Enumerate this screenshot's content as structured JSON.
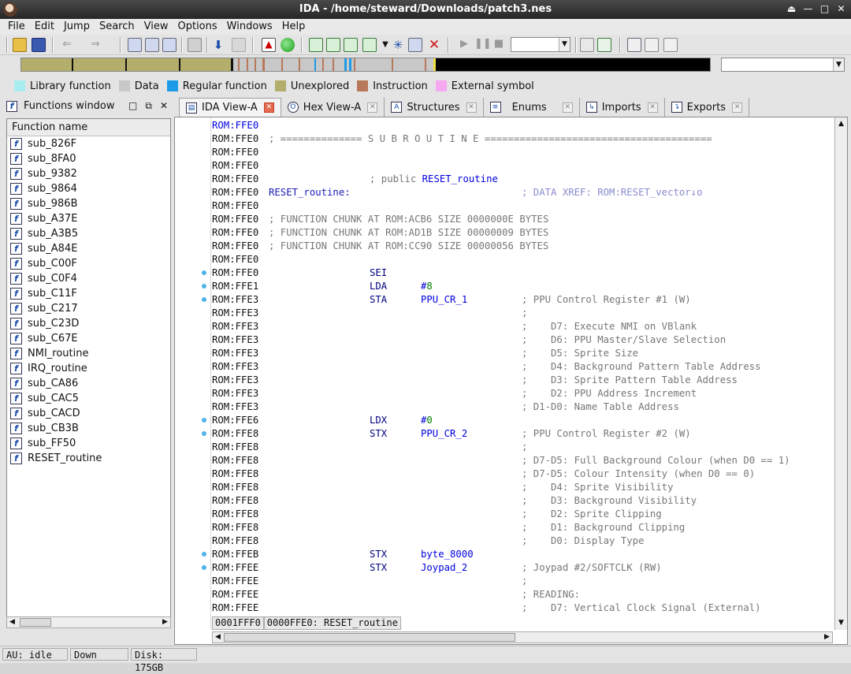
{
  "window": {
    "title": "IDA - /home/steward/Downloads/patch3.nes"
  },
  "menu": [
    "File",
    "Edit",
    "Jump",
    "Search",
    "View",
    "Options",
    "Windows",
    "Help"
  ],
  "legend": [
    {
      "label": "Library function",
      "color": "#a8eef0"
    },
    {
      "label": "Data",
      "color": "#c8c8c8"
    },
    {
      "label": "Regular function",
      "color": "#1e9be8"
    },
    {
      "label": "Unexplored",
      "color": "#b3ae6b"
    },
    {
      "label": "Instruction",
      "color": "#b8785a"
    },
    {
      "label": "External symbol",
      "color": "#f6a8f0"
    }
  ],
  "functions_panel": {
    "title": "Functions window",
    "column_header": "Function name",
    "items": [
      "sub_826F",
      "sub_8FA0",
      "sub_9382",
      "sub_9864",
      "sub_986B",
      "sub_A37E",
      "sub_A3B5",
      "sub_A84E",
      "sub_C00F",
      "sub_C0F4",
      "sub_C11F",
      "sub_C217",
      "sub_C23D",
      "sub_C67E",
      "NMI_routine",
      "IRQ_routine",
      "sub_CA86",
      "sub_CAC5",
      "sub_CACD",
      "sub_CB3B",
      "sub_FF50",
      "RESET_routine"
    ]
  },
  "tabs": [
    {
      "label": "IDA View-A",
      "icon": "ida-view-icon",
      "active": true
    },
    {
      "label": "Hex View-A",
      "icon": "hex-view-icon"
    },
    {
      "label": "Structures",
      "icon": "structures-icon"
    },
    {
      "label": "Enums",
      "icon": "enums-icon"
    },
    {
      "label": "Imports",
      "icon": "imports-icon"
    },
    {
      "label": "Exports",
      "icon": "exports-icon"
    }
  ],
  "disasm": {
    "lines": [
      {
        "addr": "ROM:FFE0",
        "blue": true
      },
      {
        "addr": "ROM:FFE0",
        "comment": "; ============== S U B R O U T I N E =======================================",
        "cpos": 72
      },
      {
        "addr": "ROM:FFE0"
      },
      {
        "addr": "ROM:FFE0"
      },
      {
        "addr": "ROM:FFE0",
        "pub": "; public ",
        "pubname": "RESET_routine"
      },
      {
        "addr": "ROM:FFE0",
        "label": "RESET_routine:",
        "xref": "; DATA XREF: ROM:RESET_vector↓o"
      },
      {
        "addr": "ROM:FFE0"
      },
      {
        "addr": "ROM:FFE0",
        "comment": "; FUNCTION CHUNK AT ROM:ACB6 SIZE 0000000E BYTES",
        "cpos": 72
      },
      {
        "addr": "ROM:FFE0",
        "comment": "; FUNCTION CHUNK AT ROM:AD1B SIZE 00000009 BYTES",
        "cpos": 72
      },
      {
        "addr": "ROM:FFE0",
        "comment": "; FUNCTION CHUNK AT ROM:CC90 SIZE 00000056 BYTES",
        "cpos": 72
      },
      {
        "addr": "ROM:FFE0"
      },
      {
        "addr": "ROM:FFE0",
        "mn": "SEI",
        "dot": true
      },
      {
        "addr": "ROM:FFE1",
        "mn": "LDA",
        "op": "#",
        "opnum": "8",
        "dot": true
      },
      {
        "addr": "ROM:FFE3",
        "mn": "STA",
        "op": "PPU_CR_1",
        "comment": "; PPU Control Register #1 (W)",
        "cpos": 393,
        "dot": true
      },
      {
        "addr": "ROM:FFE3",
        "comment": ";",
        "cpos": 393
      },
      {
        "addr": "ROM:FFE3",
        "comment": ";    D7: Execute NMI on VBlank",
        "cpos": 393
      },
      {
        "addr": "ROM:FFE3",
        "comment": ";    D6: PPU Master/Slave Selection",
        "cpos": 393
      },
      {
        "addr": "ROM:FFE3",
        "comment": ";    D5: Sprite Size",
        "cpos": 393
      },
      {
        "addr": "ROM:FFE3",
        "comment": ";    D4: Background Pattern Table Address",
        "cpos": 393
      },
      {
        "addr": "ROM:FFE3",
        "comment": ";    D3: Sprite Pattern Table Address",
        "cpos": 393
      },
      {
        "addr": "ROM:FFE3",
        "comment": ";    D2: PPU Address Increment",
        "cpos": 393
      },
      {
        "addr": "ROM:FFE3",
        "comment": "; D1-D0: Name Table Address",
        "cpos": 393
      },
      {
        "addr": "ROM:FFE6",
        "mn": "LDX",
        "op": "#",
        "opnum": "0",
        "dot": true
      },
      {
        "addr": "ROM:FFE8",
        "mn": "STX",
        "op": "PPU_CR_2",
        "comment": "; PPU Control Register #2 (W)",
        "cpos": 393,
        "dot": true
      },
      {
        "addr": "ROM:FFE8",
        "comment": ";",
        "cpos": 393
      },
      {
        "addr": "ROM:FFE8",
        "comment": "; D7-D5: Full Background Colour (when D0 == 1)",
        "cpos": 393
      },
      {
        "addr": "ROM:FFE8",
        "comment": "; D7-D5: Colour Intensity (when D0 == 0)",
        "cpos": 393
      },
      {
        "addr": "ROM:FFE8",
        "comment": ";    D4: Sprite Visibility",
        "cpos": 393
      },
      {
        "addr": "ROM:FFE8",
        "comment": ";    D3: Background Visibility",
        "cpos": 393
      },
      {
        "addr": "ROM:FFE8",
        "comment": ";    D2: Sprite Clipping",
        "cpos": 393
      },
      {
        "addr": "ROM:FFE8",
        "comment": ";    D1: Background Clipping",
        "cpos": 393
      },
      {
        "addr": "ROM:FFE8",
        "comment": ";    D0: Display Type",
        "cpos": 393
      },
      {
        "addr": "ROM:FFEB",
        "mn": "STX",
        "op": "byte_8000",
        "dot": true
      },
      {
        "addr": "ROM:FFEE",
        "mn": "STX",
        "op": "Joypad_2",
        "comment": "; Joypad #2/SOFTCLK (RW)",
        "cpos": 393,
        "dot": true
      },
      {
        "addr": "ROM:FFEE",
        "comment": ";",
        "cpos": 393
      },
      {
        "addr": "ROM:FFEE",
        "comment": "; READING:",
        "cpos": 393
      },
      {
        "addr": "ROM:FFEE",
        "comment": ";    D7: Vertical Clock Signal (External)",
        "cpos": 393
      }
    ],
    "status_offset": "0001FFF0",
    "status_location": "0000FFE0: RESET_routine"
  },
  "statusbar": {
    "au": "AU:  idle",
    "direction": "Down",
    "disk": "Disk: 175GB"
  }
}
